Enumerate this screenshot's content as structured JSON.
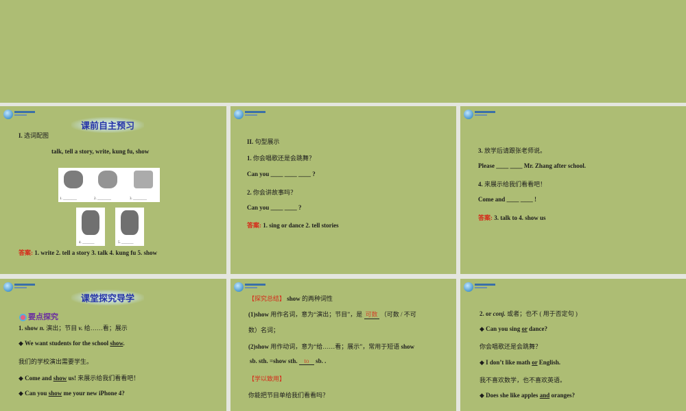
{
  "slides": [
    {
      "banner": "课前自主预习",
      "lines": [
        [
          {
            "t": "I. ",
            "b": 1
          },
          {
            "t": "选词配图",
            "cn": 1
          }
        ],
        [
          {
            "t": "talk,   tell a story,   write,   kung fu,   show"
          }
        ],
        [
          {
            "t": "答案: ",
            "red": 1
          },
          {
            "t": " 1. write  2. tell a story  3. talk  4. kung fu  5. show"
          }
        ]
      ],
      "captions": [
        "1.",
        "2.",
        "3.",
        "4.",
        "5."
      ]
    },
    {
      "lines": [
        [
          {
            "t": "II. ",
            "b": 1
          },
          {
            "t": "句型展示",
            "cn": 1
          }
        ],
        [
          {
            "t": "1. "
          },
          {
            "t": "你会唱歌还是会跳舞？",
            "cn": 1
          }
        ],
        [
          {
            "t": "Can you ____ ____ ____  ?"
          }
        ],
        [
          {
            "t": "2. "
          },
          {
            "t": "你会讲故事吗？",
            "cn": 1
          }
        ],
        [
          {
            "t": "Can you ____ ____ ?"
          }
        ],
        [
          {
            "t": "答案: ",
            "red": 1
          },
          {
            "t": "  1. sing or dance   2. tell stories"
          }
        ]
      ]
    },
    {
      "lines": [
        [
          {
            "t": "3. "
          },
          {
            "t": "放学后请跟张老师说。",
            "cn": 1
          }
        ],
        [
          {
            "t": "Please ____ ____  Mr. Zhang after school."
          }
        ],
        [
          {
            "t": "4. "
          },
          {
            "t": "来展示给我们看看吧！",
            "cn": 1
          }
        ],
        [
          {
            "t": "Come and ____ ____ !"
          }
        ],
        [
          {
            "t": "答案: ",
            "red": 1
          },
          {
            "t": "  3. talk to  4. show us"
          }
        ]
      ]
    },
    {
      "banner": "课堂探究导学",
      "subheading": "要点探究",
      "lines": [
        [
          {
            "t": "1. show "
          },
          {
            "t": "n.",
            "i": 1
          },
          {
            "t": " 演出；节目    ",
            "cn": 1
          },
          {
            "t": "v.",
            "i": 1
          },
          {
            "t": " 给……看；展示",
            "cn": 1
          }
        ],
        [
          {
            "t": "◆ We want students for the school "
          },
          {
            "t": "show",
            "u": 1
          },
          {
            "t": "."
          }
        ],
        [
          {
            "t": "我们的学校演出需要学生。",
            "cn": 1
          }
        ],
        [
          {
            "t": "◆ Come and "
          },
          {
            "t": "show",
            "u": 1
          },
          {
            "t": " us!  "
          },
          {
            "t": "来展示给我们看看吧！",
            "cn": 1
          }
        ],
        [
          {
            "t": "◆ Can you "
          },
          {
            "t": "show",
            "u": 1
          },
          {
            "t": " me your new iPhone 4?"
          }
        ]
      ]
    },
    {
      "lines": [
        [
          {
            "t": "【探究总结】",
            "red": 1,
            "cn": 1
          },
          {
            "t": "  show  "
          },
          {
            "t": "的两种词性",
            "cn": 1
          }
        ],
        [
          {
            "t": "(1)show "
          },
          {
            "t": "用作名词，意为“演出；节目”，是 ",
            "cn": 1
          },
          {
            "t": "可数",
            "blank": 1
          },
          {
            "t": " （可数 / 不可",
            "cn": 1
          }
        ],
        [
          {
            "t": "数）名词；",
            "cn": 1
          }
        ],
        [
          {
            "t": "(2)show "
          },
          {
            "t": "用作动词，意为“给……看；展示”，常用于短语 ",
            "cn": 1
          },
          {
            "t": "show"
          }
        ],
        [
          {
            "t": " sb. sth. =show sth. "
          },
          {
            "t": "to",
            "blank": 1
          },
          {
            "t": " sb.   ."
          }
        ],
        [
          {
            "t": "【学以致用】",
            "red": 1,
            "cn": 1
          }
        ],
        [
          {
            "t": "你能把节目单给我们看看吗？",
            "cn": 1
          }
        ]
      ]
    },
    {
      "lines": [
        [
          {
            "t": "2. or "
          },
          {
            "t": "conj.",
            "i": 1
          },
          {
            "t": "  或者；也不 ( 用于否定句 )",
            "cn": 1
          }
        ],
        [
          {
            "t": "◆ Can you sing "
          },
          {
            "t": "or",
            "u": 1
          },
          {
            "t": " dance?"
          }
        ],
        [
          {
            "t": "你会唱歌还是会跳舞？",
            "cn": 1
          }
        ],
        [
          {
            "t": "◆ I don’t like math "
          },
          {
            "t": "or",
            "u": 1
          },
          {
            "t": " English."
          }
        ],
        [
          {
            "t": "我不喜欢数学，也不喜欢英语。",
            "cn": 1
          }
        ],
        [
          {
            "t": "◆ Does she like apples "
          },
          {
            "t": "and",
            "u": 1
          },
          {
            "t": " oranges?"
          }
        ]
      ]
    }
  ]
}
